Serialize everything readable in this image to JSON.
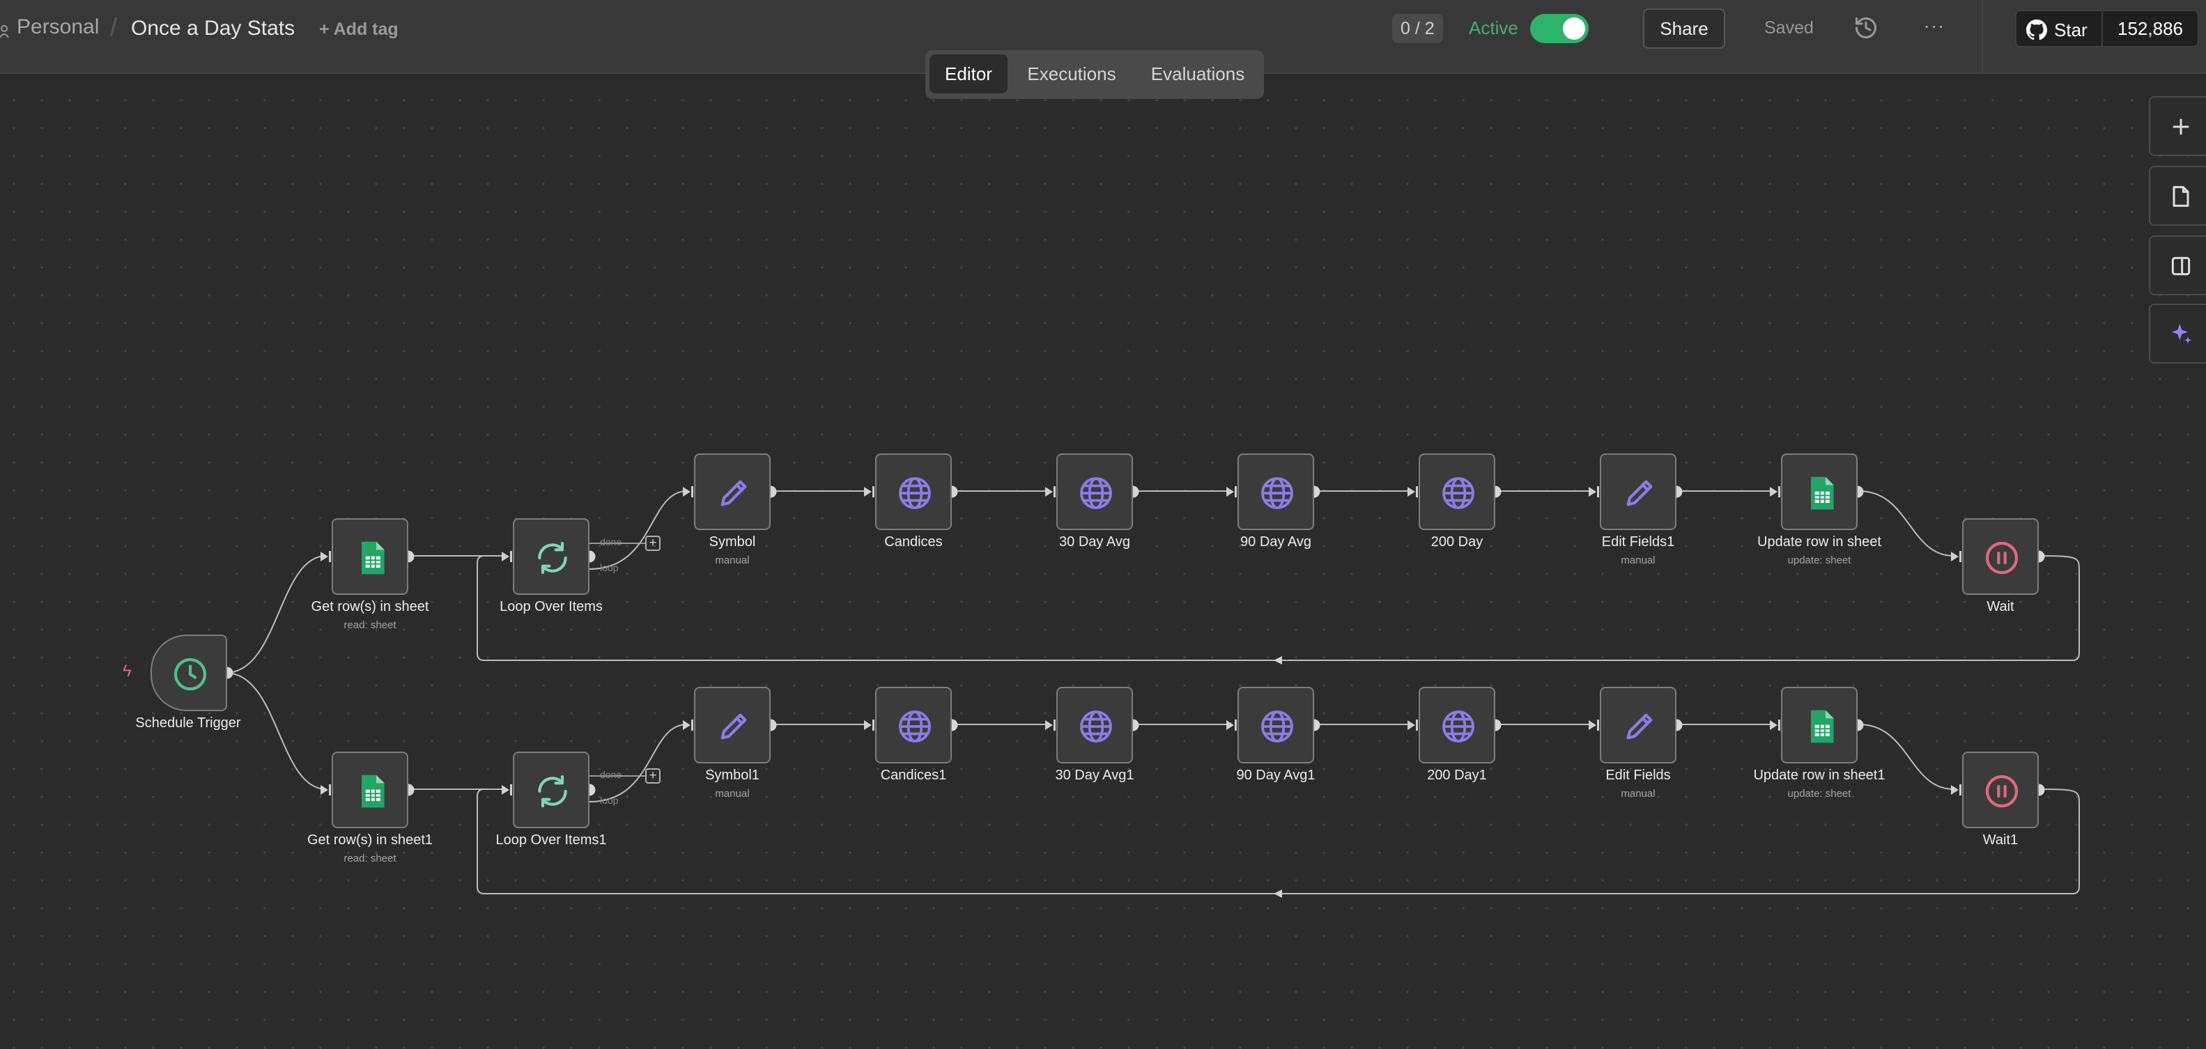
{
  "header": {
    "project": "Personal",
    "separator": "/",
    "workflow_name": "Once a Day Stats",
    "add_tag": "+ Add tag",
    "counter": "0 / 2",
    "active_label": "Active",
    "active": true,
    "share": "Share",
    "saved": "Saved",
    "more": "···",
    "github_star": "Star",
    "github_count": "152,886"
  },
  "tabs": [
    {
      "label": "Editor",
      "active": true
    },
    {
      "label": "Executions",
      "active": false
    },
    {
      "label": "Evaluations",
      "active": false
    }
  ],
  "toolbar": {
    "icons": [
      "plus-icon",
      "sticky-note-icon",
      "panel-icon",
      "sparkle-icon"
    ]
  },
  "nodes": {
    "trigger": {
      "label": "Schedule Trigger",
      "icon": "clock-icon"
    },
    "row1": [
      {
        "label": "Get row(s) in sheet",
        "sub": "read: sheet",
        "icon": "sheets-icon"
      },
      {
        "label": "Loop Over Items",
        "sub": "",
        "icon": "loop-icon",
        "port_done": "done",
        "port_loop": "loop"
      },
      {
        "label": "Symbol",
        "sub": "manual",
        "icon": "pencil-icon"
      },
      {
        "label": "Candices",
        "sub": "",
        "icon": "globe-icon"
      },
      {
        "label": "30 Day Avg",
        "sub": "",
        "icon": "globe-icon"
      },
      {
        "label": "90 Day Avg",
        "sub": "",
        "icon": "globe-icon"
      },
      {
        "label": "200 Day",
        "sub": "",
        "icon": "globe-icon"
      },
      {
        "label": "Edit Fields1",
        "sub": "manual",
        "icon": "pencil-icon"
      },
      {
        "label": "Update row in sheet",
        "sub": "update: sheet",
        "icon": "sheets-icon"
      },
      {
        "label": "Wait",
        "sub": "",
        "icon": "pause-icon"
      }
    ],
    "row2": [
      {
        "label": "Get row(s) in sheet1",
        "sub": "read: sheet",
        "icon": "sheets-icon"
      },
      {
        "label": "Loop Over Items1",
        "sub": "",
        "icon": "loop-icon",
        "port_done": "done",
        "port_loop": "loop"
      },
      {
        "label": "Symbol1",
        "sub": "manual",
        "icon": "pencil-icon"
      },
      {
        "label": "Candices1",
        "sub": "",
        "icon": "globe-icon"
      },
      {
        "label": "30 Day Avg1",
        "sub": "",
        "icon": "globe-icon"
      },
      {
        "label": "90 Day Avg1",
        "sub": "",
        "icon": "globe-icon"
      },
      {
        "label": "200 Day1",
        "sub": "",
        "icon": "globe-icon"
      },
      {
        "label": "Edit Fields",
        "sub": "manual",
        "icon": "pencil-icon"
      },
      {
        "label": "Update row in sheet1",
        "sub": "update: sheet",
        "icon": "sheets-icon"
      },
      {
        "label": "Wait1",
        "sub": "",
        "icon": "pause-icon"
      }
    ]
  },
  "colors": {
    "accent_green": "#2eb36a",
    "sheets_green": "#23a566",
    "loop_teal": "#7fd6b8",
    "purple": "#8c7ce6",
    "wait_pink": "#e0697c",
    "trigger_green": "#4fc28a"
  }
}
